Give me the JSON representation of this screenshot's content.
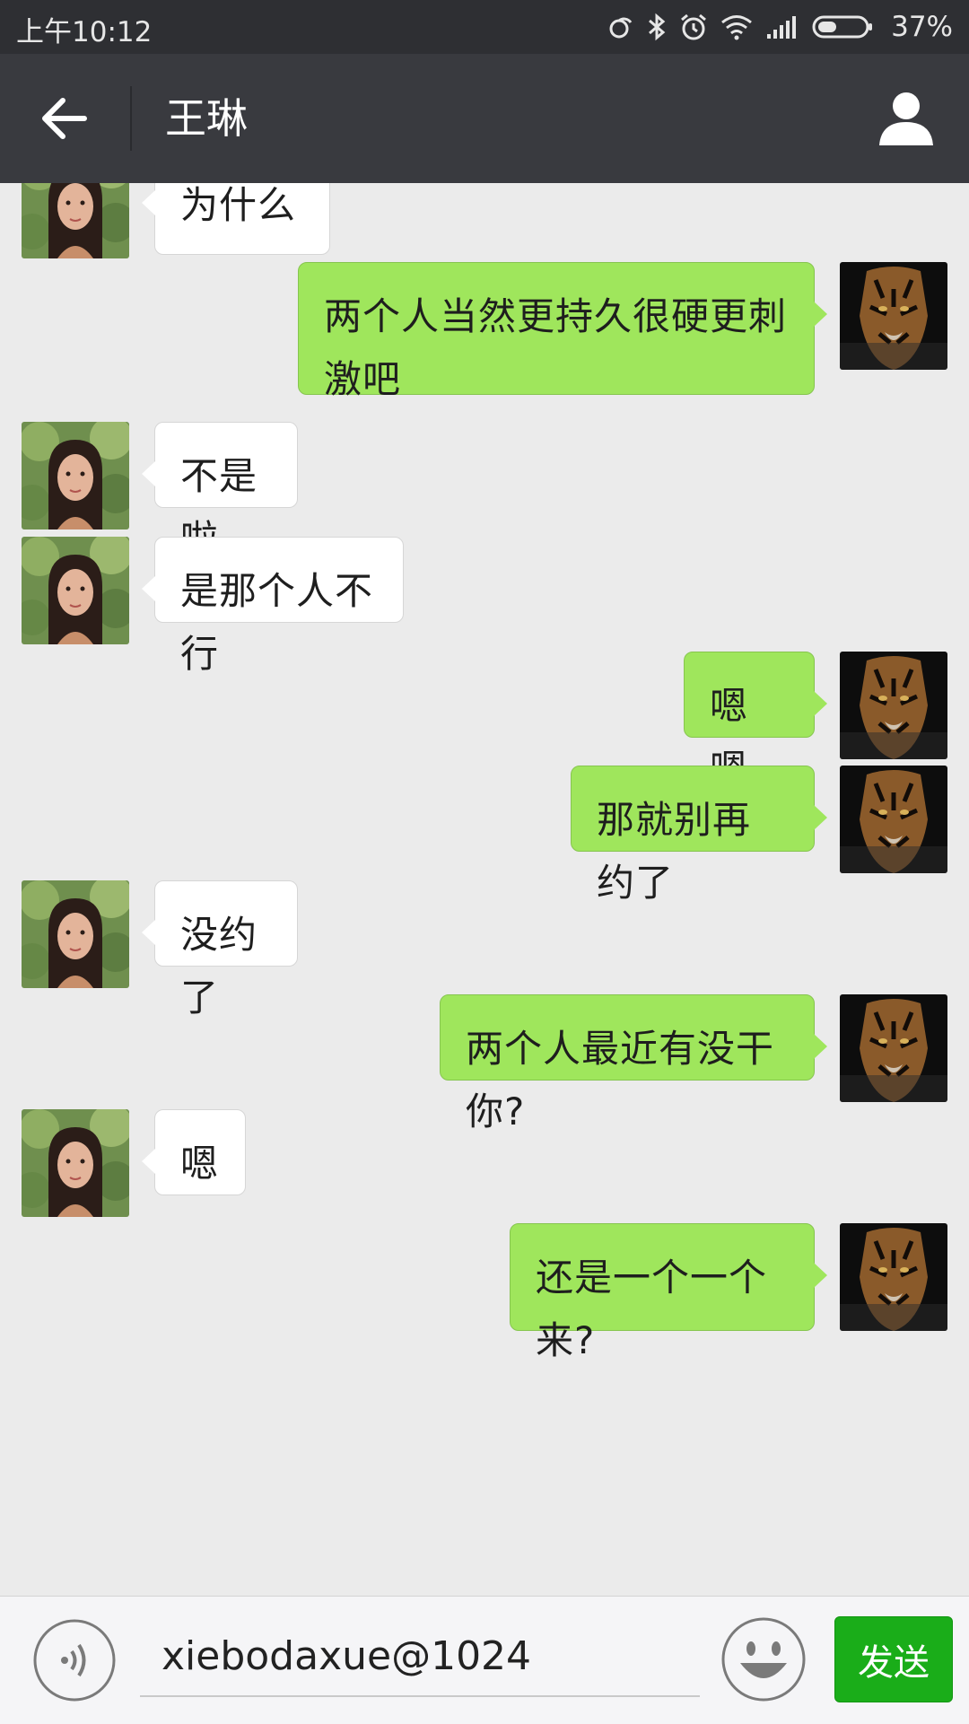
{
  "status_bar": {
    "time": "上午10:12",
    "battery_percent": "37%",
    "icons": [
      "sync-icon",
      "bluetooth-icon",
      "alarm-icon",
      "wifi-icon",
      "signal-icon",
      "battery-icon"
    ]
  },
  "header": {
    "title": "王琳",
    "back_icon": "back-arrow-icon",
    "profile_icon": "person-icon"
  },
  "messages": [
    {
      "direction": "in",
      "text": "为什么"
    },
    {
      "direction": "out",
      "text": "两个人当然更持久很硬更刺激吧"
    },
    {
      "direction": "in",
      "text": "不是啦"
    },
    {
      "direction": "in",
      "text": "是那个人不行"
    },
    {
      "direction": "out",
      "text": "嗯嗯。"
    },
    {
      "direction": "out",
      "text": "那就别再约了"
    },
    {
      "direction": "in",
      "text": "没约了"
    },
    {
      "direction": "out",
      "text": "两个人最近有没干你?"
    },
    {
      "direction": "in",
      "text": "嗯"
    },
    {
      "direction": "out",
      "text": "还是一个一个来?"
    }
  ],
  "input_bar": {
    "value": "xiebodaxue@1024",
    "send_label": "发送",
    "voice_icon": "voice-icon",
    "emoji_icon": "emoji-icon"
  },
  "colors": {
    "status_bar_bg": "#2e2f33",
    "nav_bar_bg": "#393a3f",
    "chat_bg": "#ebebeb",
    "outgoing_bubble": "#9fe65c",
    "incoming_bubble": "#ffffff",
    "send_button": "#1aad19"
  }
}
